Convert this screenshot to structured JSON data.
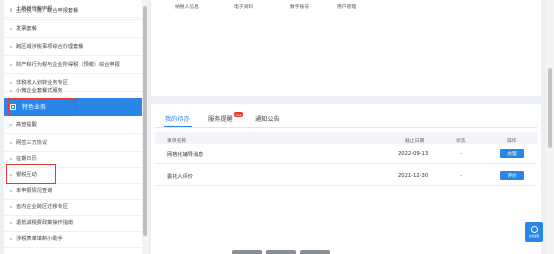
{
  "sidebar": {
    "items": [
      {
        "label": "土地增值税申报",
        "active": false
      },
      {
        "label": "土附税（费）联合申报套餐",
        "active": false
      },
      {
        "label": "发票套餐",
        "active": false
      },
      {
        "label": "跨区域涉税事项综合办理套餐",
        "active": false
      },
      {
        "label": "财产和行为税与企业所得税（预缴）综合申报",
        "active": false
      },
      {
        "label": "非税收入划转业务专区",
        "active": false
      },
      {
        "label": "小微企业套餐式服务",
        "active": false
      },
      {
        "label": "特色业务",
        "active": true
      },
      {
        "label": "高管提醒",
        "active": false
      },
      {
        "label": "网签三方协议",
        "active": false
      },
      {
        "label": "征期日历",
        "active": false
      },
      {
        "label": "银税互动",
        "active": false
      },
      {
        "label": "未申报情况查询",
        "active": false
      },
      {
        "label": "省内企业跨区迁移专区",
        "active": false
      },
      {
        "label": "退抵减税费政策操作指南",
        "active": false
      },
      {
        "label": "涉税表单填制小助手",
        "active": false
      }
    ]
  },
  "top_panel": {
    "headers": [
      "纳税人信息",
      "电子资料",
      "数字账号",
      "用户管理"
    ]
  },
  "tabs": [
    {
      "label": "我的待办",
      "active": true
    },
    {
      "label": "服务提醒",
      "active": false,
      "badge": "new"
    },
    {
      "label": "通知公告",
      "active": false
    }
  ],
  "table": {
    "columns": [
      "事项名称",
      "截止日期",
      "状态",
      "操作"
    ],
    "rows": [
      {
        "name": "网格化辅导消息",
        "deadline": "2022-09-13",
        "status": "-",
        "action": "办理"
      },
      {
        "name": "委托人评价",
        "deadline": "2021-12-30",
        "status": "-",
        "action": "评价"
      }
    ]
  },
  "float_button": {
    "label": "在线客服",
    "icon": "headset-icon"
  },
  "colors": {
    "accent": "#2a86e6",
    "highlight": "#e53935",
    "badge": "#e53935"
  }
}
